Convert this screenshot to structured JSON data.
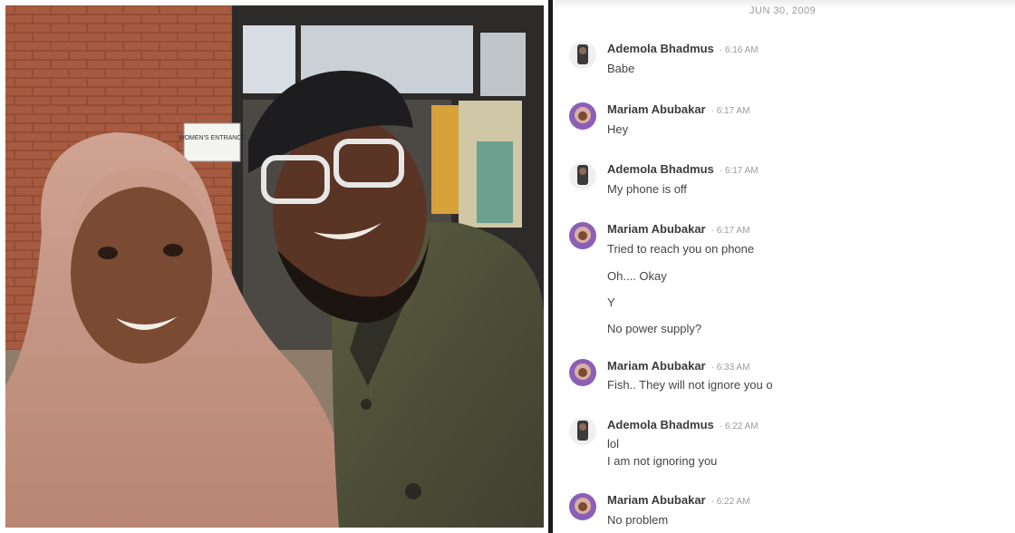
{
  "photo": {
    "sign_text": "WOMEN'S ENTRANCE"
  },
  "chat": {
    "date": "JUN 30, 2009",
    "messages": [
      {
        "sender": "Ademola Bhadmus",
        "time": "· 6:16 AM",
        "lines": [
          "Babe"
        ]
      },
      {
        "sender": "Mariam Abubakar",
        "time": "· 6:17 AM",
        "lines": [
          "Hey"
        ]
      },
      {
        "sender": "Ademola Bhadmus",
        "time": "· 6:17 AM",
        "lines": [
          "My phone is off"
        ]
      },
      {
        "sender": "Mariam Abubakar",
        "time": "· 6:17 AM",
        "lines": [
          "Tried to reach you on phone",
          "Oh.... Okay",
          "Y",
          "No power supply?"
        ]
      },
      {
        "sender": "Mariam Abubakar",
        "time": "· 6:33 AM",
        "lines": [
          "Fish.. They will not ignore you o"
        ]
      },
      {
        "sender": "Ademola Bhadmus",
        "time": "· 6:22 AM",
        "lines": [
          "lol",
          "I am not ignoring you"
        ]
      },
      {
        "sender": "Mariam Abubakar",
        "time": "· 6:22 AM",
        "lines": [
          "No problem"
        ]
      }
    ]
  }
}
